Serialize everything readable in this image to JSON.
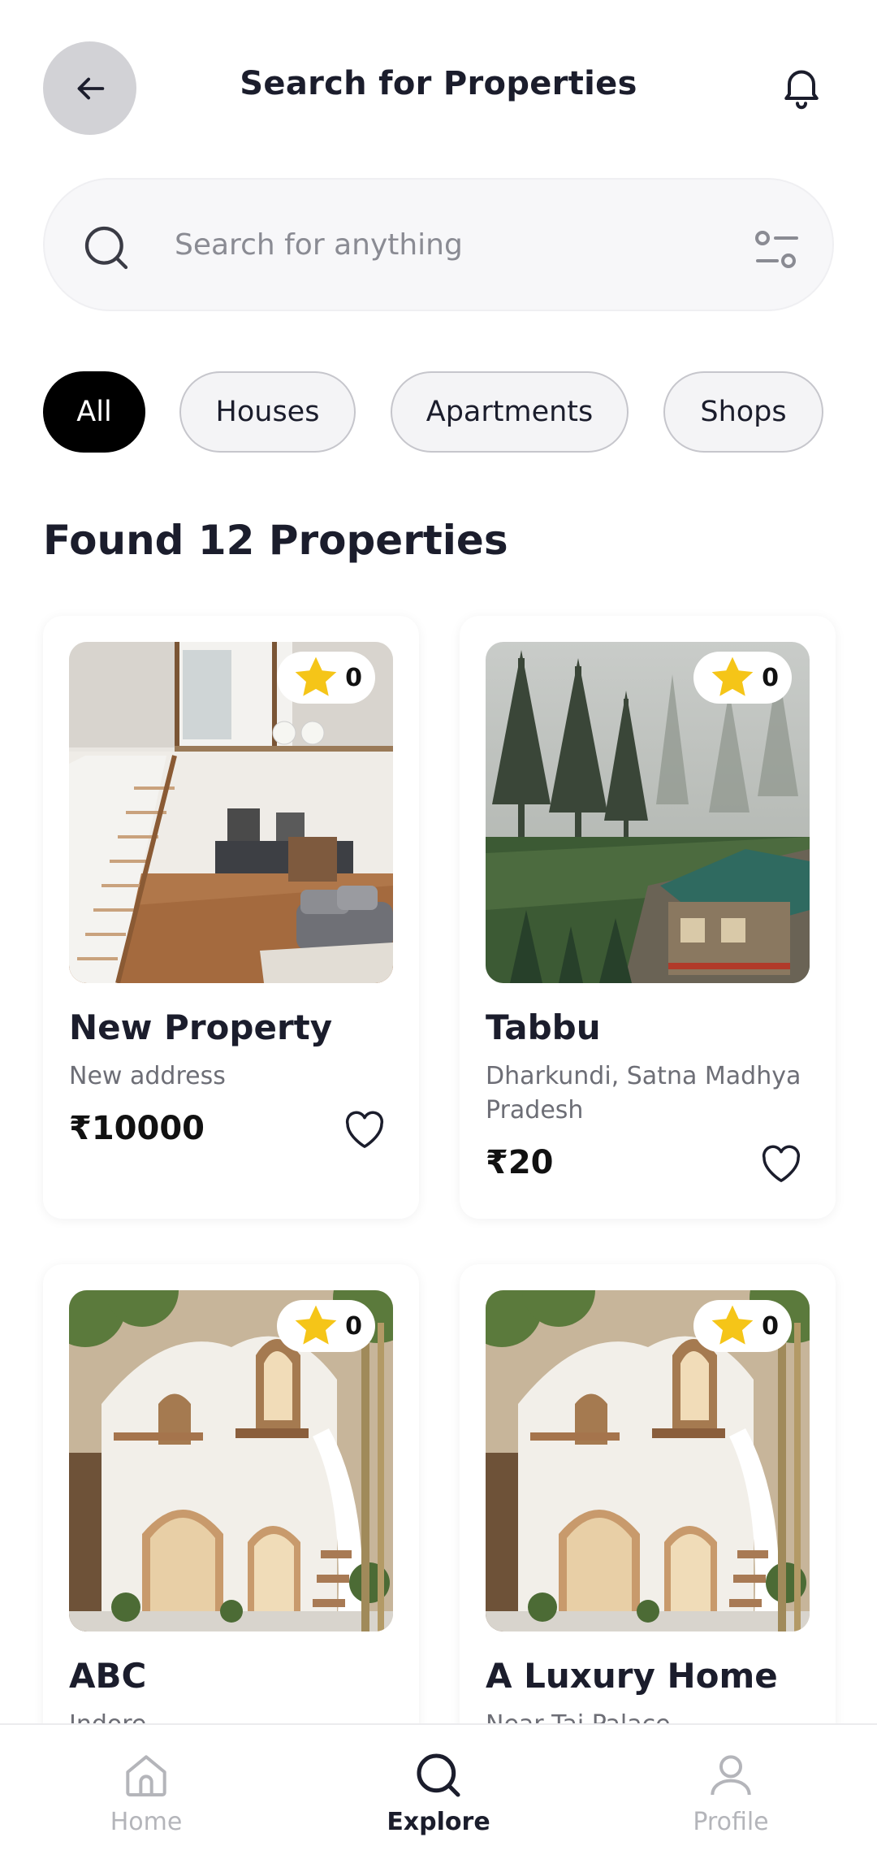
{
  "header": {
    "title": "Search for Properties",
    "back_icon": "arrow-left-icon",
    "notification_icon": "bell-icon"
  },
  "search": {
    "placeholder": "Search for anything",
    "value": "",
    "icon": "search-icon",
    "filter_icon": "filter-sliders-icon"
  },
  "categories": [
    {
      "label": "All",
      "active": true
    },
    {
      "label": "Houses",
      "active": false
    },
    {
      "label": "Apartments",
      "active": false
    },
    {
      "label": "Shops",
      "active": false
    }
  ],
  "results": {
    "title": "Found 12 Properties"
  },
  "properties": [
    {
      "name": "New Property",
      "address": "New address",
      "price": "₹10000",
      "rating": "0"
    },
    {
      "name": "Tabbu",
      "address": "Dharkundi, Satna Madhya Pradesh",
      "price": "₹20",
      "rating": "0"
    },
    {
      "name": "ABC",
      "address": "Indore",
      "price": "",
      "rating": "0"
    },
    {
      "name": "A Luxury Home",
      "address": "Near Taj Palace",
      "price": "",
      "rating": "0"
    }
  ],
  "bottom_nav": [
    {
      "label": "Home",
      "icon": "home-icon",
      "active": false
    },
    {
      "label": "Explore",
      "icon": "search-icon",
      "active": true
    },
    {
      "label": "Profile",
      "icon": "user-icon",
      "active": false
    }
  ],
  "colors": {
    "primary_text": "#1b1d2c",
    "active_chip": "#000000",
    "star": "#f5c518",
    "muted": "#b4b5ba"
  }
}
